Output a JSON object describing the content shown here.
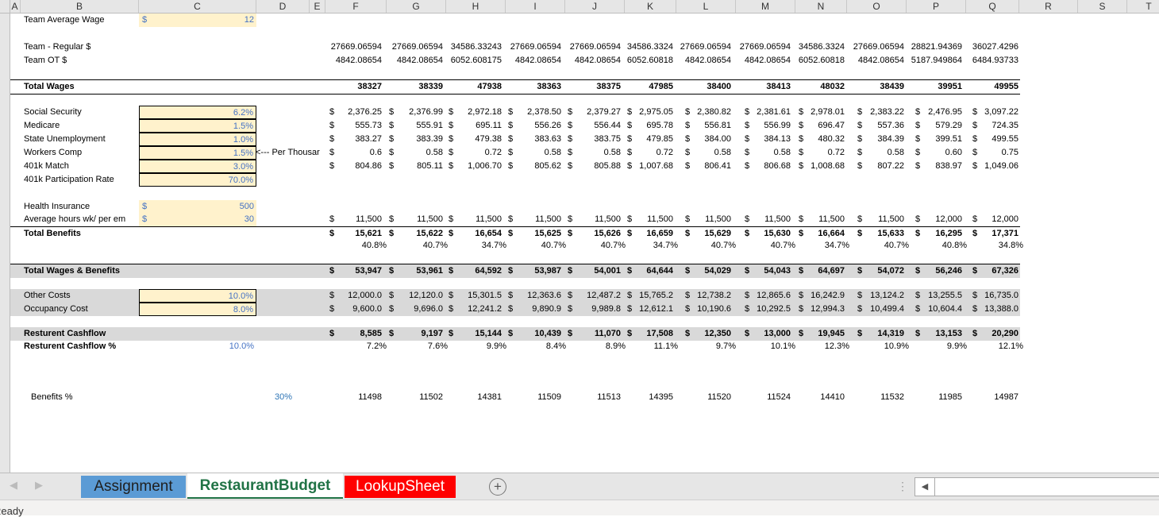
{
  "columns": [
    "A",
    "B",
    "C",
    "D",
    "E",
    "F",
    "G",
    "H",
    "I",
    "J",
    "K",
    "L",
    "M",
    "N",
    "O",
    "P",
    "Q",
    "R",
    "S",
    "T"
  ],
  "inputs": {
    "team_avg_wage": {
      "label": "Team Average Wage",
      "currency": "$",
      "value": "12"
    },
    "social_security": {
      "label": "Social Security",
      "value": "6.2%"
    },
    "medicare": {
      "label": "Medicare",
      "value": "1.5%"
    },
    "state_unemployment": {
      "label": "State Unemployment",
      "value": "1.0%"
    },
    "workers_comp": {
      "label": "Workers Comp",
      "value": "1.5%",
      "note": "<--- Per Thousar"
    },
    "k401_match": {
      "label": "401k Match",
      "value": "3.0%"
    },
    "k401_participation": {
      "label": "401k Participation Rate",
      "value": "70.0%"
    },
    "health_insurance": {
      "label": "Health Insurance",
      "currency": "$",
      "value": "500"
    },
    "avg_hours": {
      "label": "Average hours wk/ per em",
      "currency": "$",
      "value": "30"
    },
    "other_costs": {
      "label": "Other Costs",
      "value": "10.0%"
    },
    "occupancy_cost": {
      "label": "Occupancy Cost",
      "value": "8.0%"
    },
    "cashflow_pct_target": {
      "label": "Resturent Cashflow %",
      "value": "10.0%"
    },
    "benefits_pct": {
      "label": "Benefits %",
      "value": "30%"
    }
  },
  "labels": {
    "team_regular": "Team - Regular $",
    "team_ot": "Team OT $",
    "total_wages": "Total Wages",
    "total_benefits": "Total Benefits",
    "total_wages_benefits": "Total Wages & Benefits",
    "cashflow": "Resturent Cashflow"
  },
  "rows": {
    "team_regular": [
      "27669.06594",
      "27669.06594",
      "34586.33243",
      "27669.06594",
      "27669.06594",
      "34586.3324",
      "27669.06594",
      "27669.06594",
      "34586.3324",
      "27669.06594",
      "28821.94369",
      "36027.4296"
    ],
    "team_ot": [
      "4842.08654",
      "4842.08654",
      "6052.608175",
      "4842.08654",
      "4842.08654",
      "6052.60818",
      "4842.08654",
      "4842.08654",
      "6052.60818",
      "4842.08654",
      "5187.949864",
      "6484.93733"
    ],
    "total_wages": [
      "38327",
      "38339",
      "47938",
      "38363",
      "38375",
      "47985",
      "38400",
      "38413",
      "48032",
      "38439",
      "39951",
      "49955"
    ],
    "social_security": [
      "2,376.25",
      "2,376.99",
      "2,972.18",
      "2,378.50",
      "2,379.27",
      "2,975.05",
      "2,380.82",
      "2,381.61",
      "2,978.01",
      "2,383.22",
      "2,476.95",
      "3,097.22"
    ],
    "medicare": [
      "555.73",
      "555.91",
      "695.11",
      "556.26",
      "556.44",
      "695.78",
      "556.81",
      "556.99",
      "696.47",
      "557.36",
      "579.29",
      "724.35"
    ],
    "state_unemployment": [
      "383.27",
      "383.39",
      "479.38",
      "383.63",
      "383.75",
      "479.85",
      "384.00",
      "384.13",
      "480.32",
      "384.39",
      "399.51",
      "499.55"
    ],
    "workers_comp": [
      "0.6",
      "0.58",
      "0.72",
      "0.58",
      "0.58",
      "0.72",
      "0.58",
      "0.58",
      "0.72",
      "0.58",
      "0.60",
      "0.75"
    ],
    "k401_match": [
      "804.86",
      "805.11",
      "1,006.70",
      "805.62",
      "805.88",
      "1,007.68",
      "806.41",
      "806.68",
      "1,008.68",
      "807.22",
      "838.97",
      "1,049.06"
    ],
    "health": [
      "11,500",
      "11,500",
      "11,500",
      "11,500",
      "11,500",
      "11,500",
      "11,500",
      "11,500",
      "11,500",
      "11,500",
      "12,000",
      "12,000"
    ],
    "total_benefits": [
      "15,621",
      "15,622",
      "16,654",
      "15,625",
      "15,626",
      "16,659",
      "15,629",
      "15,630",
      "16,664",
      "15,633",
      "16,295",
      "17,371"
    ],
    "benefits_ratio": [
      "40.8%",
      "40.7%",
      "34.7%",
      "40.7%",
      "40.7%",
      "34.7%",
      "40.7%",
      "40.7%",
      "34.7%",
      "40.7%",
      "40.8%",
      "34.8%"
    ],
    "total_wages_benefits": [
      "53,947",
      "53,961",
      "64,592",
      "53,987",
      "54,001",
      "64,644",
      "54,029",
      "54,043",
      "64,697",
      "54,072",
      "56,246",
      "67,326"
    ],
    "other_costs": [
      "12,000.0",
      "12,120.0",
      "15,301.5",
      "12,363.6",
      "12,487.2",
      "15,765.2",
      "12,738.2",
      "12,865.6",
      "16,242.9",
      "13,124.2",
      "13,255.5",
      "16,735.0"
    ],
    "occupancy_cost": [
      "9,600.0",
      "9,696.0",
      "12,241.2",
      "9,890.9",
      "9,989.8",
      "12,612.1",
      "10,190.6",
      "10,292.5",
      "12,994.3",
      "10,499.4",
      "10,604.4",
      "13,388.0"
    ],
    "cashflow": [
      "8,585",
      "9,197",
      "15,144",
      "10,439",
      "11,070",
      "17,508",
      "12,350",
      "13,000",
      "19,945",
      "14,319",
      "13,153",
      "20,290"
    ],
    "cashflow_pct": [
      "7.2%",
      "7.6%",
      "9.9%",
      "8.4%",
      "8.9%",
      "11.1%",
      "9.7%",
      "10.1%",
      "12.3%",
      "10.9%",
      "9.9%",
      "12.1%"
    ],
    "benefits_pct": [
      "11498",
      "11502",
      "14381",
      "11509",
      "11513",
      "14395",
      "11520",
      "11524",
      "14410",
      "11532",
      "11985",
      "14987"
    ]
  },
  "sheet_tabs": [
    {
      "label": "Assignment",
      "bg": "#5b9bd5",
      "color": "#1f1f1f"
    },
    {
      "label": "RestaurantBudget",
      "bg": "#ffffff",
      "color": "#217346"
    },
    {
      "label": "LookupSheet",
      "bg": "#ff0000",
      "color": "#ffffff"
    }
  ],
  "currency_symbol": "$",
  "status_text": "Ready"
}
